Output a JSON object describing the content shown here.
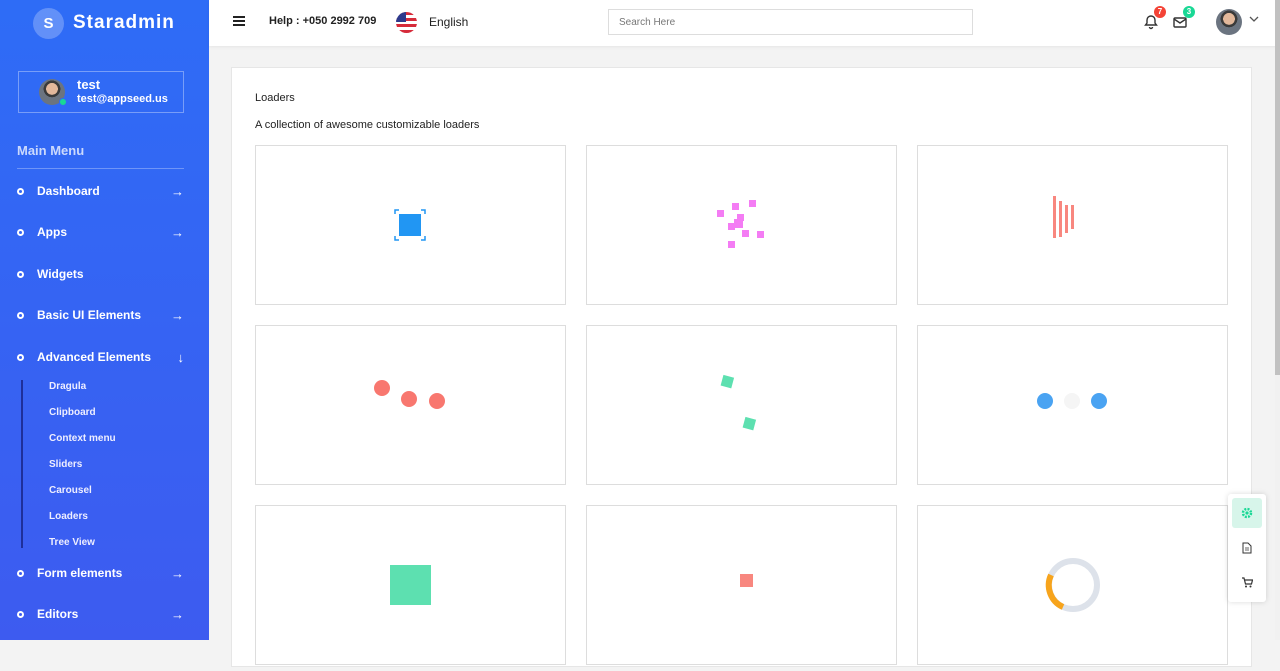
{
  "brand": {
    "logo_letter": "S",
    "name": "Staradmin"
  },
  "profile": {
    "name": "test",
    "email": "test@appseed.us"
  },
  "menu": {
    "title": "Main Menu",
    "items": [
      {
        "label": "Dashboard",
        "arrow": "→"
      },
      {
        "label": "Apps",
        "arrow": "→"
      },
      {
        "label": "Widgets",
        "arrow": ""
      },
      {
        "label": "Basic UI Elements",
        "arrow": "→"
      },
      {
        "label": "Advanced Elements",
        "arrow": "↓"
      },
      {
        "label": "Form elements",
        "arrow": "→"
      },
      {
        "label": "Editors",
        "arrow": "→"
      }
    ],
    "submenu": [
      "Dragula",
      "Clipboard",
      "Context menu",
      "Sliders",
      "Carousel",
      "Loaders",
      "Tree View"
    ]
  },
  "header": {
    "help": "Help : +050 2992 709",
    "language": "English",
    "search_placeholder": "Search Here",
    "notifications_count": "7",
    "messages_count": "3"
  },
  "page": {
    "title": "Loaders",
    "description": "A collection of awesome customizable loaders"
  },
  "colors": {
    "sidebar": "#2e6cf6",
    "blue": "#2196f3",
    "pink": "#f47cf4",
    "salmon": "#f8877f",
    "green": "#5de0b0",
    "orange": "#f7a41c",
    "badge_red": "#f44336",
    "badge_green": "#19d895"
  }
}
